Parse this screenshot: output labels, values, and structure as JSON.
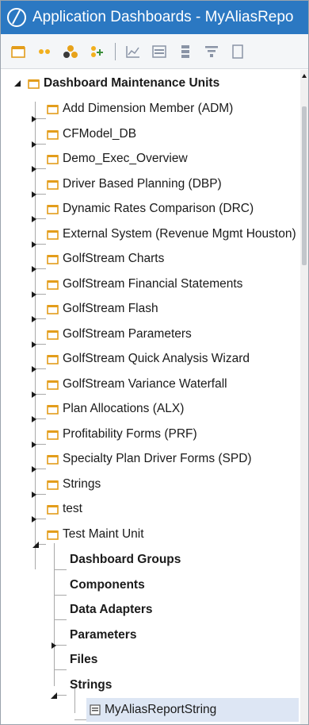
{
  "window": {
    "title": "Application Dashboards - MyAliasRepo"
  },
  "toolbar": {
    "buttons": [
      {
        "icon": "dashboard-maintenance-unit-icon"
      },
      {
        "icon": "dashboard-group-icon"
      },
      {
        "icon": "dashboard-components-icon"
      },
      {
        "icon": "add-dashboard-icon"
      },
      {
        "icon": "chart-icon"
      },
      {
        "icon": "grid-icon"
      },
      {
        "icon": "data-adapter-icon"
      },
      {
        "icon": "filter-icon"
      },
      {
        "icon": "files-icon"
      }
    ]
  },
  "tree": {
    "root": {
      "label": "Dashboard Maintenance Units",
      "expanded": true
    },
    "units": [
      {
        "label": "Add Dimension Member (ADM)"
      },
      {
        "label": "CFModel_DB"
      },
      {
        "label": "Demo_Exec_Overview"
      },
      {
        "label": "Driver Based Planning (DBP)"
      },
      {
        "label": "Dynamic Rates Comparison (DRC)"
      },
      {
        "label": "External System (Revenue Mgmt Houston)"
      },
      {
        "label": "GolfStream Charts"
      },
      {
        "label": "GolfStream Financial Statements"
      },
      {
        "label": "GolfStream Flash"
      },
      {
        "label": "GolfStream Parameters"
      },
      {
        "label": "GolfStream Quick Analysis Wizard"
      },
      {
        "label": "GolfStream Variance Waterfall"
      },
      {
        "label": "Plan Allocations (ALX)"
      },
      {
        "label": "Profitability Forms (PRF)"
      },
      {
        "label": "Specialty Plan Driver Forms (SPD)"
      },
      {
        "label": "Strings"
      },
      {
        "label": "test"
      },
      {
        "label": "Test Maint Unit"
      }
    ],
    "test_maint_children": [
      {
        "label": "Dashboard Groups"
      },
      {
        "label": "Components"
      },
      {
        "label": "Data Adapters"
      },
      {
        "label": "Parameters"
      },
      {
        "label": "Files"
      },
      {
        "label": "Strings"
      }
    ],
    "string_item": {
      "label": "MyAliasReportString",
      "selected": true
    }
  }
}
